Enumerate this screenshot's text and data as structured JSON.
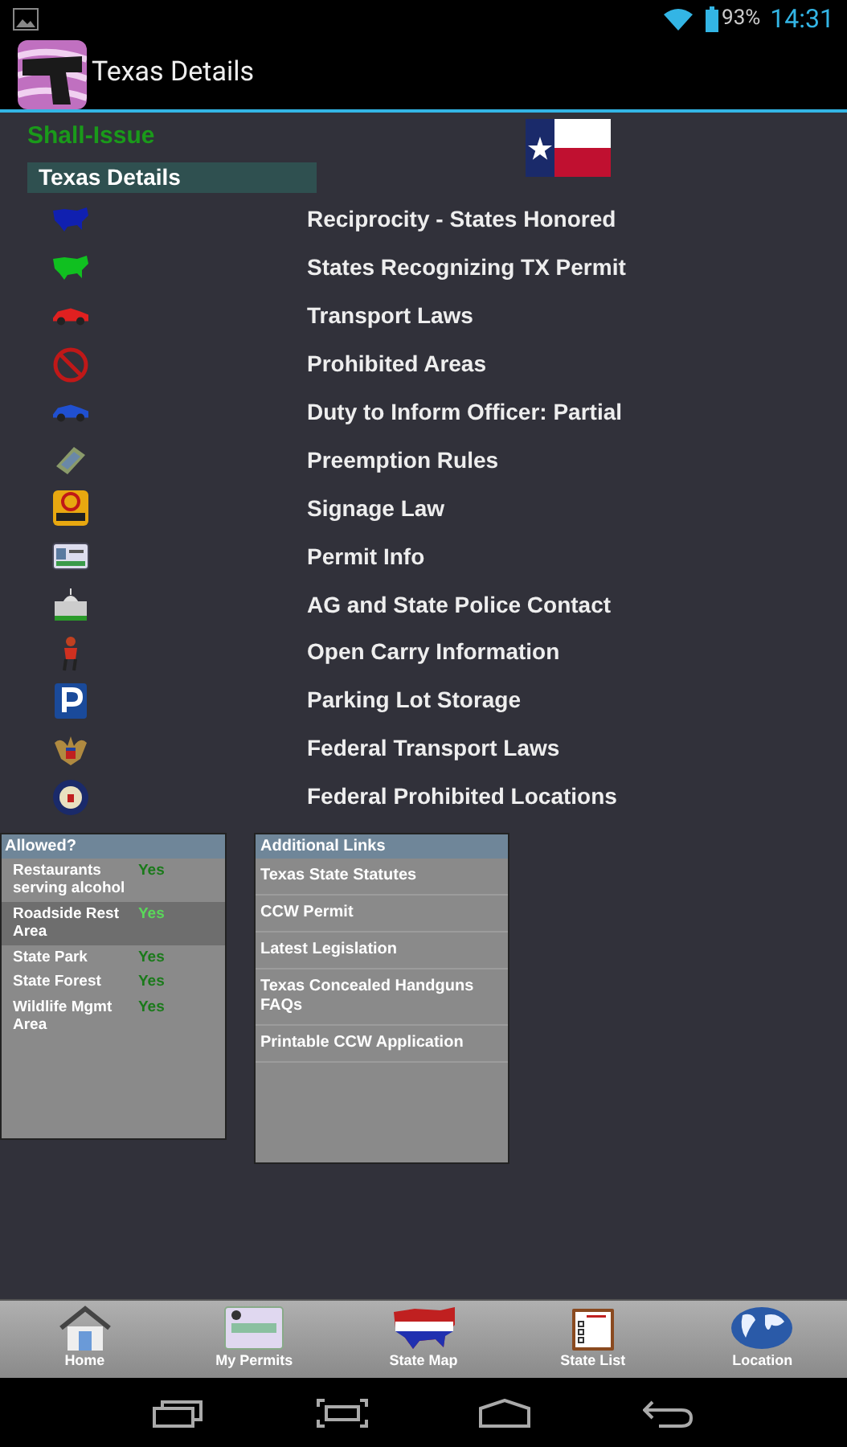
{
  "status_bar": {
    "battery": "93%",
    "time": "14:31"
  },
  "action_bar": {
    "title": "Texas Details"
  },
  "permit_status": "Shall-Issue",
  "section_header": "Texas Details",
  "menu_items": [
    {
      "kind": "map-blue",
      "label": "Reciprocity - States Honored"
    },
    {
      "kind": "map-green",
      "label": "States Recognizing TX Permit"
    },
    {
      "kind": "car-red",
      "label": "Transport Laws"
    },
    {
      "kind": "no-sign",
      "label": "Prohibited Areas"
    },
    {
      "kind": "car-blue",
      "label": "Duty to Inform Officer: Partial"
    },
    {
      "kind": "book",
      "label": "Preemption Rules"
    },
    {
      "kind": "sign",
      "label": "Signage Law"
    },
    {
      "kind": "card",
      "label": "Permit Info"
    },
    {
      "kind": "building",
      "label": "AG and State Police Contact"
    },
    {
      "kind": "person",
      "label": "Open Carry Information"
    },
    {
      "kind": "parking",
      "label": "Parking Lot Storage"
    },
    {
      "kind": "eagle",
      "label": "Federal Transport Laws"
    },
    {
      "kind": "seal",
      "label": "Federal Prohibited Locations"
    }
  ],
  "allowed": {
    "title": "Allowed?",
    "rows": [
      {
        "place": "Restaurants serving alcohol",
        "value": "Yes",
        "selected": false
      },
      {
        "place": "Roadside Rest Area",
        "value": "Yes",
        "selected": true
      },
      {
        "place": "State Park",
        "value": "Yes",
        "selected": false
      },
      {
        "place": "State Forest",
        "value": "Yes",
        "selected": false
      },
      {
        "place": "Wildlife Mgmt Area",
        "value": "Yes",
        "selected": false
      }
    ]
  },
  "additional_links": {
    "title": "Additional Links",
    "items": [
      "Texas State Statutes",
      "CCW Permit",
      "Latest Legislation",
      "Texas Concealed Handguns FAQs",
      "Printable CCW Application"
    ]
  },
  "bottom_nav": [
    {
      "kind": "home",
      "label": "Home"
    },
    {
      "kind": "permit",
      "label": "My Permits"
    },
    {
      "kind": "map",
      "label": "State Map"
    },
    {
      "kind": "list",
      "label": "State List"
    },
    {
      "kind": "globe",
      "label": "Location"
    }
  ]
}
